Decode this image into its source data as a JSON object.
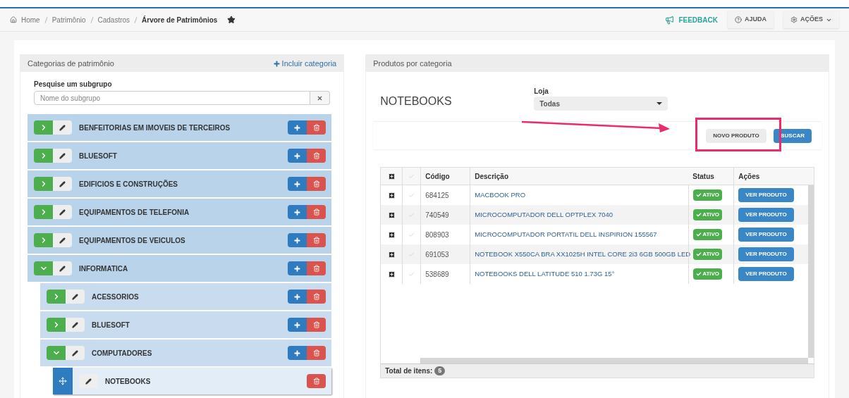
{
  "breadcrumb": [
    {
      "label": "Home",
      "current": false
    },
    {
      "label": "Patrimônio",
      "current": false
    },
    {
      "label": "Cadastros",
      "current": false
    },
    {
      "label": "Árvore de Patrimônios",
      "current": true
    }
  ],
  "favorite": true,
  "top_actions": [
    {
      "kind": "feedback",
      "label": "FEEDBACK"
    },
    {
      "kind": "help",
      "label": "AJUDA"
    },
    {
      "kind": "menu",
      "label": "AÇÕES"
    }
  ],
  "categories_panel": {
    "title": "Categorias de patrimônio",
    "add_link": "Incluir categoria",
    "search": {
      "label": "Pesquise um subgrupo",
      "placeholder": "Nome do subgrupo"
    },
    "tree": [
      {
        "label": "BENFEITORIAS EM IMOVEIS DE TERCEIROS",
        "expanded": false,
        "selected": false
      },
      {
        "label": "BLUESOFT",
        "expanded": false,
        "selected": false
      },
      {
        "label": "EDIFICIOS E CONSTRUÇÕES",
        "expanded": false,
        "selected": false
      },
      {
        "label": "EQUIPAMENTOS DE TELEFONIA",
        "expanded": false,
        "selected": false
      },
      {
        "label": "EQUIPAMENTOS DE VEICULOS",
        "expanded": false,
        "selected": false
      },
      {
        "label": "INFORMATICA",
        "expanded": true,
        "selected": false,
        "children": [
          {
            "label": "ACESSORIOS",
            "expanded": false,
            "selected": false
          },
          {
            "label": "BLUESOFT",
            "expanded": false,
            "selected": false
          },
          {
            "label": "COMPUTADORES",
            "expanded": true,
            "selected": false,
            "children": [
              {
                "label": "NOTEBOOKS",
                "expanded": false,
                "selected": true
              }
            ]
          }
        ]
      }
    ]
  },
  "products_panel": {
    "title": "Produtos por categoria",
    "category": "NOTEBOOKS",
    "store": {
      "label": "Loja",
      "value": "Todas"
    },
    "buttons": [
      {
        "kind": "default",
        "label": "NOVO PRODUTO"
      },
      {
        "kind": "primary",
        "label": "BUSCAR"
      }
    ],
    "table": {
      "columns": [
        "Código",
        "Descrição",
        "Status",
        "Ações"
      ],
      "rows": [
        {
          "code": "684125",
          "description": "MACBOOK PRO",
          "checked": false,
          "status": "ATIVO",
          "action": "VER PRODUTO"
        },
        {
          "code": "740549",
          "description": "MICROCOMPUTADOR DELL OPTPLEX 7040",
          "checked": false,
          "status": "ATIVO",
          "action": "VER PRODUTO"
        },
        {
          "code": "808903",
          "description": "MICROCOMPUTADOR PORTATIL DELL INSPIRION 155567",
          "checked": false,
          "status": "ATIVO",
          "action": "VER PRODUTO"
        },
        {
          "code": "691053",
          "description": "NOTEBOOK X550CA BRA XX1025H INTEL CORE 2i3 6GB 500GB LED",
          "checked": false,
          "status": "ATIVO",
          "action": "VER PRODUTO"
        },
        {
          "code": "538689",
          "description": "NOTEBOOKS DELL LATITUDE 510 1.73G 15°",
          "checked": false,
          "status": "ATIVO",
          "action": "VER PRODUTO"
        }
      ],
      "total_label": "Total de itens:",
      "total": "5"
    }
  }
}
